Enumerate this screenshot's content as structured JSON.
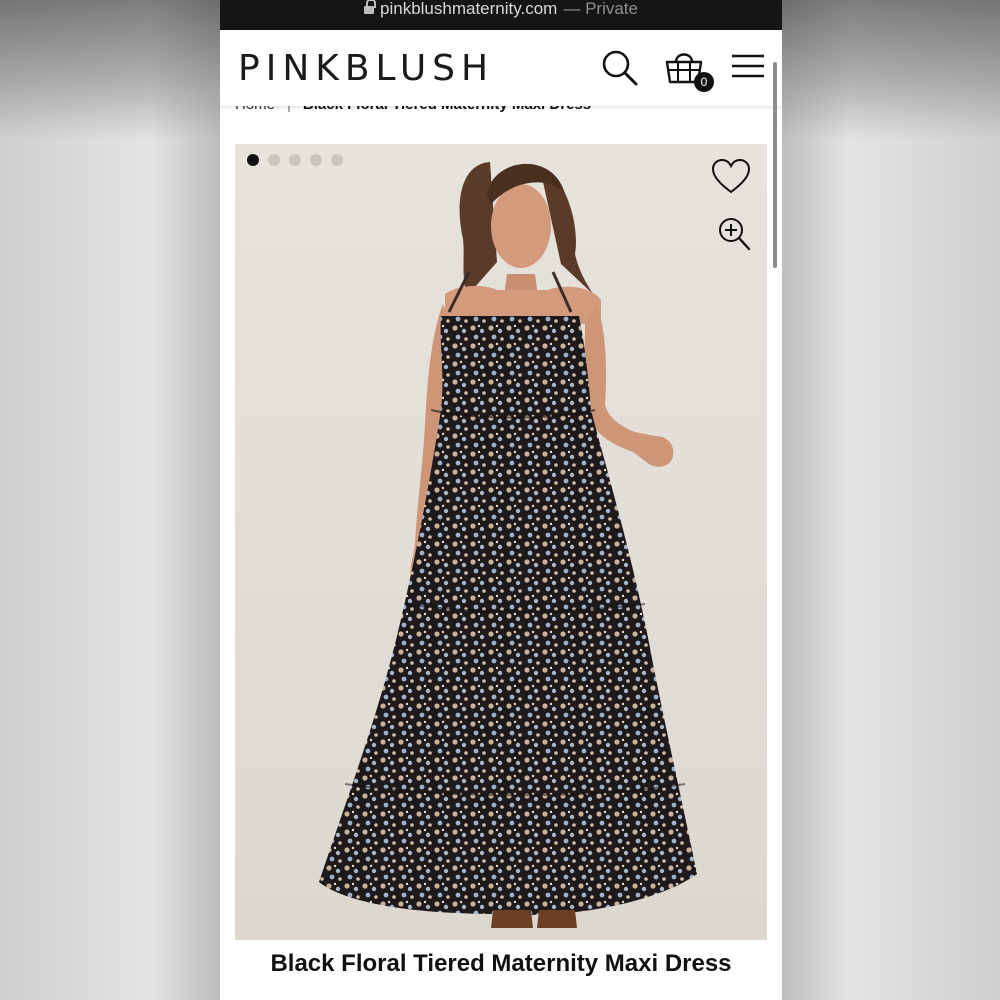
{
  "browser": {
    "url": "pinkblushmaternity.com",
    "privacy_label": "— Private"
  },
  "header": {
    "logo": "PINKBLUSH",
    "cart_count": "0"
  },
  "breadcrumb": {
    "home": "Home",
    "separator": "|",
    "current": "Black Floral Tiered Maternity Maxi Dress"
  },
  "gallery": {
    "total_images": 5,
    "active_index": 0
  },
  "product": {
    "title": "Black Floral Tiered Maternity Maxi Dress"
  },
  "icons": {
    "lock": "lock-icon",
    "search": "search-icon",
    "cart": "shopping-bag-icon",
    "menu": "hamburger-menu-icon",
    "wishlist": "heart-icon",
    "zoom": "zoom-in-icon"
  }
}
